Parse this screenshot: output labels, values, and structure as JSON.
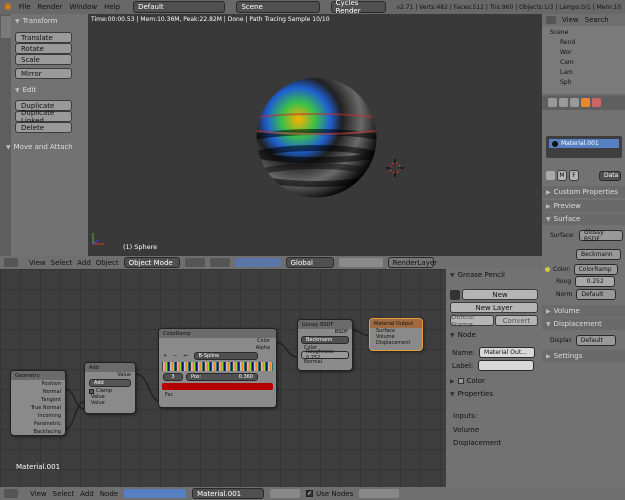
{
  "topbar": {
    "menus": [
      "File",
      "Render",
      "Window",
      "Help"
    ],
    "layout": "Default",
    "scene": "Scene",
    "engine": "Cycles Render",
    "stats": "v2.71 | Verts:482 | Faces:512 | Tris:960 | Objects:1/3 | Lamps:0/1 | Mem:10"
  },
  "toolshelf": {
    "tabs": [
      "Tools",
      "Crt",
      "Rel",
      "Anm",
      "Phy",
      "Grease"
    ],
    "transform_title": "Transform",
    "translate": "Translate",
    "rotate": "Rotate",
    "scale": "Scale",
    "mirror": "Mirror",
    "edit_title": "Edit",
    "duplicate": "Duplicate",
    "duplicate_linked": "Duplicate Linked",
    "delete": "Delete",
    "move_attach": "Move and Attach"
  },
  "viewport": {
    "info": "Time:00:00.53 | Mem:10.36M, Peak:22.82M | Done | Path Tracing Sample 10/10",
    "object_label": "(1) Sphere"
  },
  "view3d_header": {
    "menus": [
      "View",
      "Select",
      "Add",
      "Object"
    ],
    "mode": "Object Mode",
    "orientation": "Global",
    "layer": "RenderLayer"
  },
  "outliner": {
    "menus": [
      "View",
      "Search"
    ],
    "items": [
      "Scene",
      "Rend",
      "Wor",
      "Cam",
      "Lam",
      "Sph"
    ]
  },
  "properties": {
    "material_name": "Material.001",
    "material_mode": "Data",
    "sections": {
      "custom_props": "Custom Properties",
      "preview": "Preview",
      "surface": "Surface",
      "volume": "Volume",
      "displacement": "Displacement",
      "settings": "Settings"
    },
    "surface_label": "Surface:",
    "surface_value": "Glossy BSDF",
    "dist_value": "Beckmann",
    "color_label": "Color:",
    "color_value": "ColorRamp",
    "rough_label": "Roug",
    "rough_value": "0.252",
    "norm_label": "Norm",
    "norm_value": "Default",
    "displ_label": "Displac",
    "displ_value": "Default"
  },
  "node_sidebar": {
    "grease_title": "Grease Pencil",
    "new": "New",
    "new_layer": "New Layer",
    "delete_frame": "Delete Frame",
    "convert": "Convert",
    "node_title": "Node",
    "name_label": "Name:",
    "name_value": "Material Out...",
    "label_label": "Label:",
    "color_title": "Color",
    "props_title": "Properties",
    "inputs": "Inputs:",
    "volume": "Volume",
    "displacement": "Displacement"
  },
  "node_editor": {
    "material_label": "Material.001",
    "geometry": {
      "title": "Geometry",
      "outputs": [
        "Position",
        "Normal",
        "Tangent",
        "True Normal",
        "Incoming",
        "Parametric",
        "Backfacing"
      ]
    },
    "add": {
      "title": "Add",
      "out": "Value",
      "op": "Add",
      "clamp": "Clamp",
      "in1": "Value",
      "in2": "Value"
    },
    "ramp": {
      "title": "ColorRamp",
      "out_color": "Color",
      "out_alpha": "Alpha",
      "interp": "B-Spline",
      "index": "3",
      "pos": "Pos:",
      "pos_value": "0.360",
      "fac": "Fac"
    },
    "glossy": {
      "title": "Glossy BSDF",
      "out": "BSDF",
      "dist": "Beckmann",
      "in_color": "Color",
      "in_rough": "Roughness: 0.252",
      "in_normal": "Normal"
    },
    "output": {
      "title": "Material Output",
      "in_surface": "Surface",
      "in_volume": "Volume",
      "in_disp": "Displacement"
    }
  },
  "bottombar": {
    "menus": [
      "View",
      "Select",
      "Add",
      "Node"
    ],
    "material": "Material.001",
    "use_nodes": "Use Nodes"
  },
  "colors": {
    "accent": "#5680c2",
    "header": "#6f6f6f",
    "ramp_red": "#b40000"
  }
}
